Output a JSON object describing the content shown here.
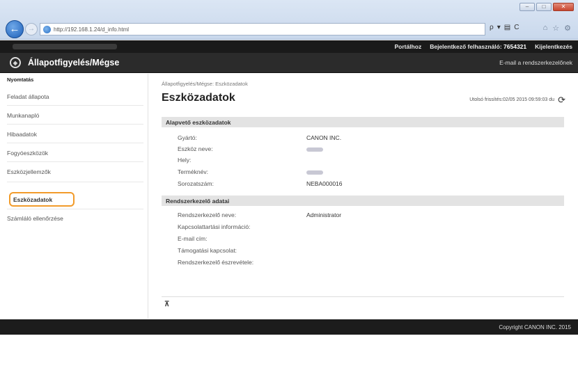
{
  "browser": {
    "url": "http://192.168.1.24/d_info.html",
    "search_symbol": "ρ",
    "refresh_symbol": "C"
  },
  "top_strip": {
    "portal_link": "Portálhoz",
    "logged_in_label": "Bejelentkező felhasználó:",
    "user_id": "7654321",
    "logout_link": "Kijelentkezés"
  },
  "header": {
    "title": "Állapotfigyelés/Mégse",
    "mail_admin_link": "E-mail a rendszerkezelőnek"
  },
  "sidebar": {
    "heading": "Nyomtatás",
    "items": [
      {
        "label": "Feladat állapota"
      },
      {
        "label": "Munkanapló"
      },
      {
        "label": "Hibaadatok"
      },
      {
        "label": "Fogyóeszközök"
      },
      {
        "label": "Eszközjellemzők"
      },
      {
        "label": "Eszközadatok"
      },
      {
        "label": "Számláló ellenőrzése"
      }
    ]
  },
  "main": {
    "breadcrumb": "Állapotfigyelés/Mégse: Eszközadatok",
    "title": "Eszközadatok",
    "last_update": "Utolsó frissítés:02/05 2015 09:59:03 du",
    "sections": [
      {
        "header": "Alapvető eszközadatok",
        "rows": [
          {
            "label": "Gyártó:",
            "value": "CANON INC."
          },
          {
            "label": "Eszköz neve:",
            "value": ""
          },
          {
            "label": "Hely:",
            "value": ""
          },
          {
            "label": "Terméknév:",
            "value": ""
          },
          {
            "label": "Sorozatszám:",
            "value": "NEBA000016"
          }
        ]
      },
      {
        "header": "Rendszerkezelő adatai",
        "rows": [
          {
            "label": "Rendszerkezelő neve:",
            "value": "Administrator"
          },
          {
            "label": "Kapcsolattartási információ:",
            "value": ""
          },
          {
            "label": "E-mail cím:",
            "value": ""
          },
          {
            "label": "Támogatási kapcsolat:",
            "value": ""
          },
          {
            "label": "Rendszerkezelő észrevétele:",
            "value": ""
          }
        ]
      }
    ]
  },
  "footer": {
    "copyright": "Copyright CANON INC. 2015"
  },
  "colors": {
    "active_outline": "#f29b2a",
    "header_bg": "#2b2b2b",
    "section_bg": "#e3e3e3"
  }
}
